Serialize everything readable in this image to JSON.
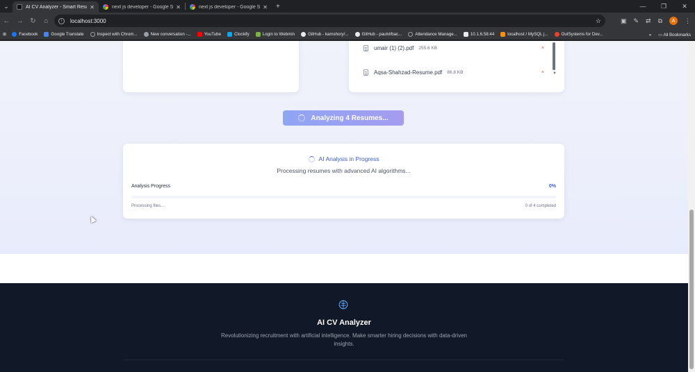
{
  "browser": {
    "tabs": [
      {
        "title": "AI CV Analyzer - Smart Resume",
        "active": true
      },
      {
        "title": "next js developer - Google Sea",
        "active": false
      },
      {
        "title": "next js developer - Google Sea",
        "active": false
      }
    ],
    "url": "localhost:3000",
    "profile_initial": "A",
    "bookmarks": [
      "Facebook",
      "Google Translate",
      "Inspect with Chrom...",
      "New conversation -...",
      "YouTube",
      "Clockify",
      "Login to Webmin",
      "GitHub - kamshory/...",
      "GitHub - paulvl/bac...",
      "Attendance Manage...",
      "10.1.6.58:44",
      "localhost / MySQL j...",
      "OutSystems for Dev..."
    ],
    "all_bookmarks": "All Bookmarks",
    "bookmark_colors": [
      "#1877f2",
      "#4285f4",
      "#9aa0a6",
      "#9aa0a6",
      "#ff0000",
      "#03a9f4",
      "#7cb342",
      "#e8eaed",
      "#e8eaed",
      "#9aa0a6",
      "#9aa0a6",
      "#f29111",
      "#e8402a"
    ]
  },
  "uploaded_files": [
    {
      "name": "umair (1) (2).pdf",
      "size": "255.6 KB",
      "remove": "×"
    },
    {
      "name": "Aqsa-Shahzad-Resume.pdf",
      "size": "86.8 KB",
      "remove": "×"
    }
  ],
  "analyze_button": {
    "label": "Analyzing 4 Resumes..."
  },
  "progress": {
    "title": "AI Analysis in Progress",
    "subtitle": "Processing resumes with advanced AI algorithms...",
    "label": "Analysis Progress",
    "percent_text": "0%",
    "fraction": 0,
    "status": "Processing files...",
    "count_text": "0 of 4 completed"
  },
  "footer": {
    "brand": "AI CV Analyzer",
    "description": "Revolutionizing recruitment with artificial intelligence. Make smarter hiring decisions with data-driven insights."
  },
  "icons": {
    "brand": "brain-icon",
    "doc": "document-icon",
    "spinner": "loading-spinner-icon"
  },
  "colors": {
    "accent": "#4f6ee8",
    "footer_bg": "#111827",
    "remove": "#ef4444"
  }
}
